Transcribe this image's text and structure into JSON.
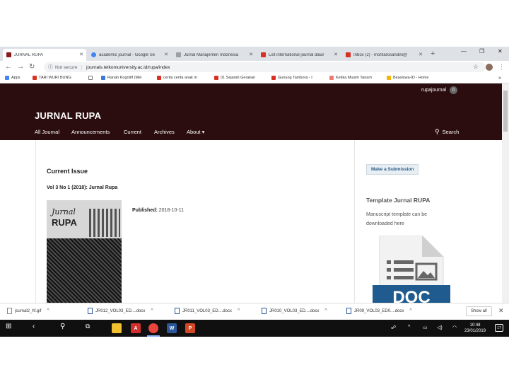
{
  "tabs": [
    {
      "title": "JURNAL RUPA",
      "active": true,
      "color": "#8b1a1a"
    },
    {
      "title": "academic journal - Google Se",
      "active": false,
      "color": "#4285f4"
    },
    {
      "title": "Jurnal Manajemen Indonesia",
      "active": false,
      "color": "#9aa0a6"
    },
    {
      "title": "List international journal dalar",
      "active": false,
      "color": "#d93025"
    },
    {
      "title": "Inbox (2) - moritarosandini@",
      "active": false,
      "color": "#d93025"
    }
  ],
  "addressbar": {
    "security": "Not secure",
    "url": "journals.telkomuniversity.ac.id/rupa/index"
  },
  "bookmarks": [
    {
      "label": "Apps"
    },
    {
      "label": "TARI WURI BUNG"
    },
    {
      "label": ""
    },
    {
      "label": "Ranah Kognitif (Mel"
    },
    {
      "label": "cerita cerita anak m"
    },
    {
      "label": "01 Sejarah Gerakan"
    },
    {
      "label": "Gunung Tambora - I"
    },
    {
      "label": "Ketika Musim Tanam"
    },
    {
      "label": "Beasiswa-ID - Home"
    }
  ],
  "site": {
    "user": "rupajournal",
    "user_badge": "0",
    "title": "JURNAL RUPA",
    "menu": [
      "All Journal",
      "Announcements",
      "Current",
      "Archives",
      "About ▾"
    ],
    "search": "Search"
  },
  "main": {
    "heading": "Current Issue",
    "issue": "Vol 3 No 1 (2018): Jurnal Rupa",
    "cover_title_1": "Jurnal",
    "cover_title_2": "RUPA",
    "published_label": "Published:",
    "published_date": "2018-10-11"
  },
  "sidebar": {
    "submit": "Make a Submission",
    "template_head": "Template Jurnal RUPA",
    "template_text": "Manuscript template can be downloaded here",
    "doc_label": "DOC"
  },
  "downloads": [
    "jcurnal2_hf.gif",
    "JR012_VOL03_ED....docx",
    "JR011_VOL03_ED....docx",
    "JR010_VOL03_ED....docx",
    "JR09_VOL03_ED0....docx"
  ],
  "downloads_showall": "Show all",
  "clock": {
    "time": "10:48",
    "date": "23/01/2019"
  },
  "notif_count": "17"
}
